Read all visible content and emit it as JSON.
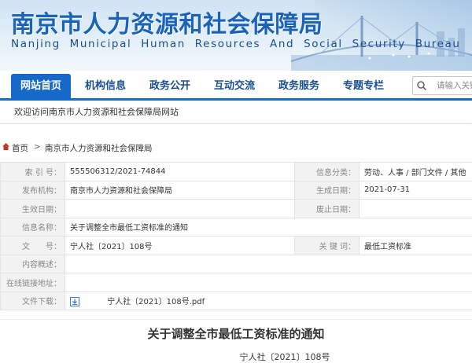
{
  "header": {
    "title": "南京市人力资源和社会保障局",
    "subtitle": "Nanjing Municipal Human Resources And Social Security Bureau"
  },
  "nav": {
    "items": [
      "网站首页",
      "机构信息",
      "政务公开",
      "互动交流",
      "政务服务",
      "专题专栏"
    ],
    "active_index": 0,
    "search_placeholder": "请输入关键"
  },
  "welcome": "欢迎访问南京市人力资源和社会保障局网站",
  "breadcrumb": {
    "home": "首页",
    "separator": ">",
    "current": "南京市人力资源和社会保障局"
  },
  "info": {
    "index_label": "索 引 号：",
    "index_value": "555506312/2021-74844",
    "category_label": "信息分类：",
    "category_value": "劳动、人事 / 部门文件 / 其他",
    "publisher_label": "发布机构：",
    "publisher_value": "南京市人力资源和社会保障局",
    "created_label": "生成日期：",
    "created_value": "2021-07-31",
    "effective_label": "生效日期：",
    "effective_value": "",
    "abolished_label": "废止日期：",
    "abolished_value": "",
    "name_label": "信息名称：",
    "name_value": "关于调整全市最低工资标准的通知",
    "docno_label": "文　　号：",
    "docno_value": "宁人社〔2021〕108号",
    "keyword_label": "关 键 词：",
    "keyword_value": "最低工资标准",
    "summary_label": "内容概述：",
    "summary_value": "",
    "online_label": "在线链接地址：",
    "online_value": "",
    "download_label": "文件下载：",
    "download_file": "宁人社〔2021〕108号.pdf"
  },
  "article": {
    "title": "关于调整全市最低工资标准的通知",
    "docno": "宁人社〔2021〕108号"
  },
  "colors": {
    "brand_blue": "#1669c9",
    "title_blue": "#1a63b8",
    "label_bg": "#f2f2f2"
  }
}
